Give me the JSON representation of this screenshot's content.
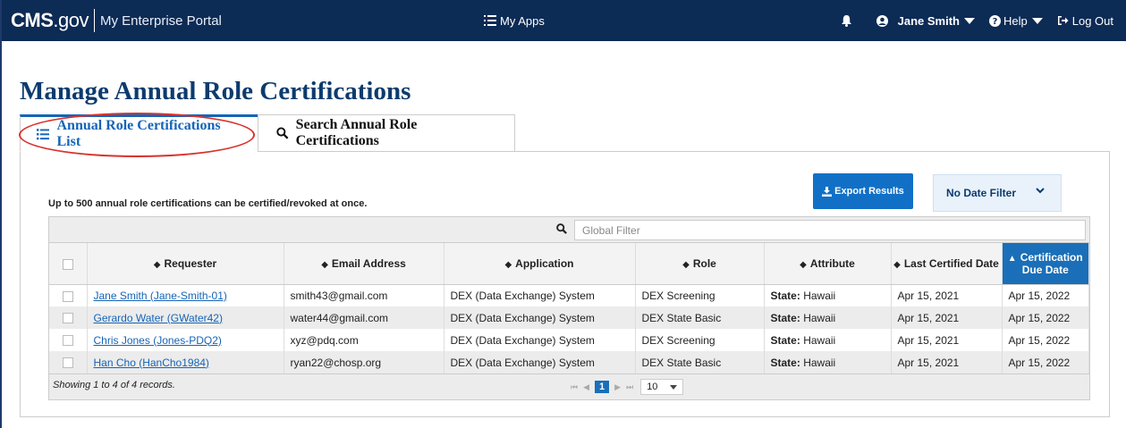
{
  "header": {
    "brand": "CMS",
    "brand_suffix": ".gov",
    "portal": "My Enterprise Portal",
    "my_apps": "My Apps",
    "user": "Jane Smith",
    "help": "Help",
    "logout": "Log Out"
  },
  "page_title": "Manage Annual Role Certifications",
  "tabs": [
    {
      "label": "Annual Role Certifications List",
      "active": true
    },
    {
      "label": "Search Annual Role Certifications",
      "active": false
    }
  ],
  "note": "Up to 500 annual role certifications can be certified/revoked at once.",
  "export_label": "Export Results",
  "date_filter": "No Date Filter",
  "global_filter_placeholder": "Global Filter",
  "columns": [
    "Requester",
    "Email Address",
    "Application",
    "Role",
    "Attribute",
    "Last Certified Date",
    "Certification Due Date"
  ],
  "rows": [
    {
      "requester": "Jane Smith (Jane-Smith-01)",
      "email": "smith43@gmail.com",
      "application": "DEX (Data Exchange) System",
      "role": "DEX Screening",
      "attr_key": "State:",
      "attr_val": "Hawaii",
      "last": "Apr 15, 2021",
      "due": "Apr 15, 2022"
    },
    {
      "requester": "Gerardo Water (GWater42)",
      "email": "water44@gmail.com",
      "application": "DEX (Data Exchange) System",
      "role": "DEX State Basic",
      "attr_key": "State:",
      "attr_val": "Hawaii",
      "last": "Apr 15, 2021",
      "due": "Apr 15, 2022"
    },
    {
      "requester": "Chris Jones (Jones-PDQ2)",
      "email": "xyz@pdq.com",
      "application": "DEX (Data Exchange) System",
      "role": "DEX Screening",
      "attr_key": "State:",
      "attr_val": "Hawaii",
      "last": "Apr 15, 2021",
      "due": "Apr 15, 2022"
    },
    {
      "requester": "Han Cho (HanCho1984)",
      "email": "ryan22@chosp.org",
      "application": "DEX (Data Exchange) System",
      "role": "DEX State Basic",
      "attr_key": "State:",
      "attr_val": "Hawaii",
      "last": "Apr 15, 2021",
      "due": "Apr 15, 2022"
    }
  ],
  "footer": {
    "showing": "Showing 1 to 4 of 4 records.",
    "current_page": "1",
    "per_page": "10"
  },
  "colors": {
    "nav_bg": "#0c2b55",
    "accent": "#1564b7",
    "title": "#0c3b6e",
    "highlight_oval": "#d9322d"
  }
}
